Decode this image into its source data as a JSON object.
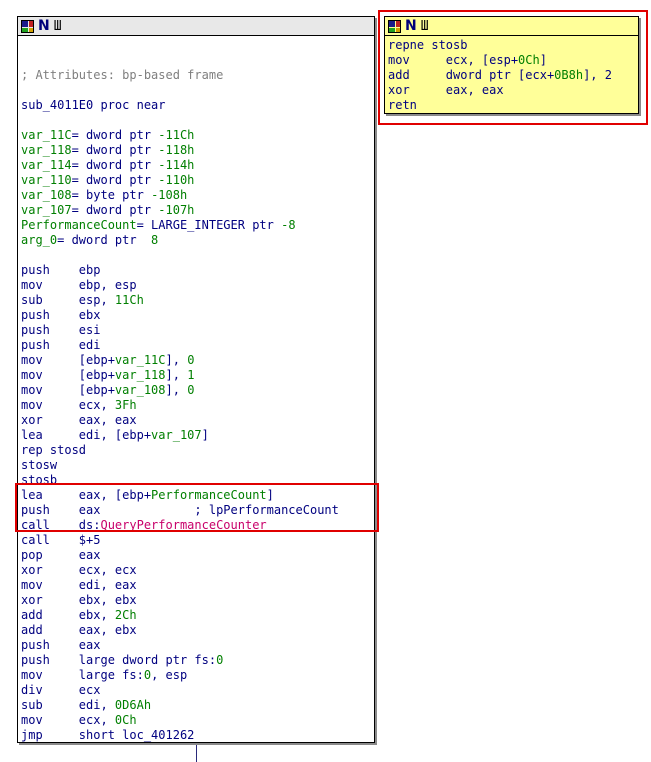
{
  "main_node": {
    "title_icons": [
      "grid-icon",
      "n-icon",
      "w-icon"
    ],
    "lines": [
      {
        "parts": [
          {
            "t": "",
            "c": ""
          }
        ]
      },
      {
        "parts": [
          {
            "t": "",
            "c": ""
          }
        ]
      },
      {
        "parts": [
          {
            "t": "; Attributes: bp-based frame",
            "c": "cmt"
          }
        ]
      },
      {
        "parts": [
          {
            "t": "",
            "c": ""
          }
        ]
      },
      {
        "parts": [
          {
            "t": "sub_4011E0 proc near",
            "c": ""
          }
        ]
      },
      {
        "parts": [
          {
            "t": "",
            "c": ""
          }
        ]
      },
      {
        "parts": [
          {
            "t": "var_11C",
            "c": "var"
          },
          {
            "t": "= dword ptr ",
            "c": ""
          },
          {
            "t": "-11Ch",
            "c": "num"
          }
        ]
      },
      {
        "parts": [
          {
            "t": "var_118",
            "c": "var"
          },
          {
            "t": "= dword ptr ",
            "c": ""
          },
          {
            "t": "-118h",
            "c": "num"
          }
        ]
      },
      {
        "parts": [
          {
            "t": "var_114",
            "c": "var"
          },
          {
            "t": "= dword ptr ",
            "c": ""
          },
          {
            "t": "-114h",
            "c": "num"
          }
        ]
      },
      {
        "parts": [
          {
            "t": "var_110",
            "c": "var"
          },
          {
            "t": "= dword ptr ",
            "c": ""
          },
          {
            "t": "-110h",
            "c": "num"
          }
        ]
      },
      {
        "parts": [
          {
            "t": "var_108",
            "c": "var"
          },
          {
            "t": "= byte ptr ",
            "c": ""
          },
          {
            "t": "-108h",
            "c": "num"
          }
        ]
      },
      {
        "parts": [
          {
            "t": "var_107",
            "c": "var"
          },
          {
            "t": "= dword ptr ",
            "c": ""
          },
          {
            "t": "-107h",
            "c": "num"
          }
        ]
      },
      {
        "parts": [
          {
            "t": "PerformanceCount",
            "c": "var"
          },
          {
            "t": "= LARGE_INTEGER ptr ",
            "c": ""
          },
          {
            "t": "-8",
            "c": "num"
          }
        ]
      },
      {
        "parts": [
          {
            "t": "arg_0",
            "c": "var"
          },
          {
            "t": "= dword ptr  ",
            "c": ""
          },
          {
            "t": "8",
            "c": "num"
          }
        ]
      },
      {
        "parts": [
          {
            "t": "",
            "c": ""
          }
        ]
      },
      {
        "parts": [
          {
            "t": "push    ebp",
            "c": ""
          }
        ]
      },
      {
        "parts": [
          {
            "t": "mov     ebp, esp",
            "c": ""
          }
        ]
      },
      {
        "parts": [
          {
            "t": "sub     esp, ",
            "c": ""
          },
          {
            "t": "11Ch",
            "c": "num"
          }
        ]
      },
      {
        "parts": [
          {
            "t": "push    ebx",
            "c": ""
          }
        ]
      },
      {
        "parts": [
          {
            "t": "push    esi",
            "c": ""
          }
        ]
      },
      {
        "parts": [
          {
            "t": "push    edi",
            "c": ""
          }
        ]
      },
      {
        "parts": [
          {
            "t": "mov     [ebp+",
            "c": ""
          },
          {
            "t": "var_11C",
            "c": "var"
          },
          {
            "t": "], ",
            "c": ""
          },
          {
            "t": "0",
            "c": "num"
          }
        ]
      },
      {
        "parts": [
          {
            "t": "mov     [ebp+",
            "c": ""
          },
          {
            "t": "var_118",
            "c": "var"
          },
          {
            "t": "], ",
            "c": ""
          },
          {
            "t": "1",
            "c": "num"
          }
        ]
      },
      {
        "parts": [
          {
            "t": "mov     [ebp+",
            "c": ""
          },
          {
            "t": "var_108",
            "c": "var"
          },
          {
            "t": "], ",
            "c": ""
          },
          {
            "t": "0",
            "c": "num"
          }
        ]
      },
      {
        "parts": [
          {
            "t": "mov     ecx, ",
            "c": ""
          },
          {
            "t": "3Fh",
            "c": "num"
          }
        ]
      },
      {
        "parts": [
          {
            "t": "xor     eax, eax",
            "c": ""
          }
        ]
      },
      {
        "parts": [
          {
            "t": "lea     edi, [ebp+",
            "c": ""
          },
          {
            "t": "var_107",
            "c": "var"
          },
          {
            "t": "]",
            "c": ""
          }
        ]
      },
      {
        "parts": [
          {
            "t": "rep stosd",
            "c": ""
          }
        ]
      },
      {
        "parts": [
          {
            "t": "stosw",
            "c": ""
          }
        ]
      },
      {
        "parts": [
          {
            "t": "stosb",
            "c": ""
          }
        ]
      },
      {
        "parts": [
          {
            "t": "lea     eax, [ebp+",
            "c": ""
          },
          {
            "t": "PerformanceCount",
            "c": "var"
          },
          {
            "t": "]",
            "c": ""
          }
        ]
      },
      {
        "parts": [
          {
            "t": "push    eax             ",
            "c": ""
          },
          {
            "t": "; lpPerformanceCount",
            "c": ""
          }
        ]
      },
      {
        "parts": [
          {
            "t": "call    ds:",
            "c": ""
          },
          {
            "t": "QueryPerformanceCounter",
            "c": "fn"
          }
        ]
      },
      {
        "parts": [
          {
            "t": "call    $+5",
            "c": ""
          }
        ]
      },
      {
        "parts": [
          {
            "t": "pop     eax",
            "c": ""
          }
        ]
      },
      {
        "parts": [
          {
            "t": "xor     ecx, ecx",
            "c": ""
          }
        ]
      },
      {
        "parts": [
          {
            "t": "mov     edi, eax",
            "c": ""
          }
        ]
      },
      {
        "parts": [
          {
            "t": "xor     ebx, ebx",
            "c": ""
          }
        ]
      },
      {
        "parts": [
          {
            "t": "add     ebx, ",
            "c": ""
          },
          {
            "t": "2Ch",
            "c": "num"
          }
        ]
      },
      {
        "parts": [
          {
            "t": "add     eax, ebx",
            "c": ""
          }
        ]
      },
      {
        "parts": [
          {
            "t": "push    eax",
            "c": ""
          }
        ]
      },
      {
        "parts": [
          {
            "t": "push    large dword ptr fs:",
            "c": ""
          },
          {
            "t": "0",
            "c": "num"
          }
        ]
      },
      {
        "parts": [
          {
            "t": "mov     large fs:",
            "c": ""
          },
          {
            "t": "0",
            "c": "num"
          },
          {
            "t": ", esp",
            "c": ""
          }
        ]
      },
      {
        "parts": [
          {
            "t": "div     ecx",
            "c": ""
          }
        ]
      },
      {
        "parts": [
          {
            "t": "sub     edi, ",
            "c": ""
          },
          {
            "t": "0D6Ah",
            "c": "num"
          }
        ]
      },
      {
        "parts": [
          {
            "t": "mov     ecx, ",
            "c": ""
          },
          {
            "t": "0Ch",
            "c": "num"
          }
        ]
      },
      {
        "parts": [
          {
            "t": "jmp     short loc_401262",
            "c": ""
          }
        ]
      }
    ]
  },
  "small_node": {
    "title_icons": [
      "grid-icon",
      "n-icon",
      "w-icon"
    ],
    "lines": [
      {
        "parts": [
          {
            "t": "repne stosb",
            "c": ""
          }
        ]
      },
      {
        "parts": [
          {
            "t": "mov     ecx, [esp+",
            "c": ""
          },
          {
            "t": "0Ch",
            "c": "num"
          },
          {
            "t": "]",
            "c": ""
          }
        ]
      },
      {
        "parts": [
          {
            "t": "add     dword ptr [ecx+",
            "c": ""
          },
          {
            "t": "0B8h",
            "c": "num"
          },
          {
            "t": "], 2",
            "c": ""
          }
        ]
      },
      {
        "parts": [
          {
            "t": "xor     eax, eax",
            "c": ""
          }
        ]
      },
      {
        "parts": [
          {
            "t": "retn",
            "c": ""
          }
        ]
      }
    ]
  },
  "colors": {
    "highlight": "#e00000",
    "small_node_bg": "#ffff99",
    "variable": "#007f00",
    "function": "#c8006a",
    "comment": "#7f7f7f",
    "code": "#000080"
  }
}
